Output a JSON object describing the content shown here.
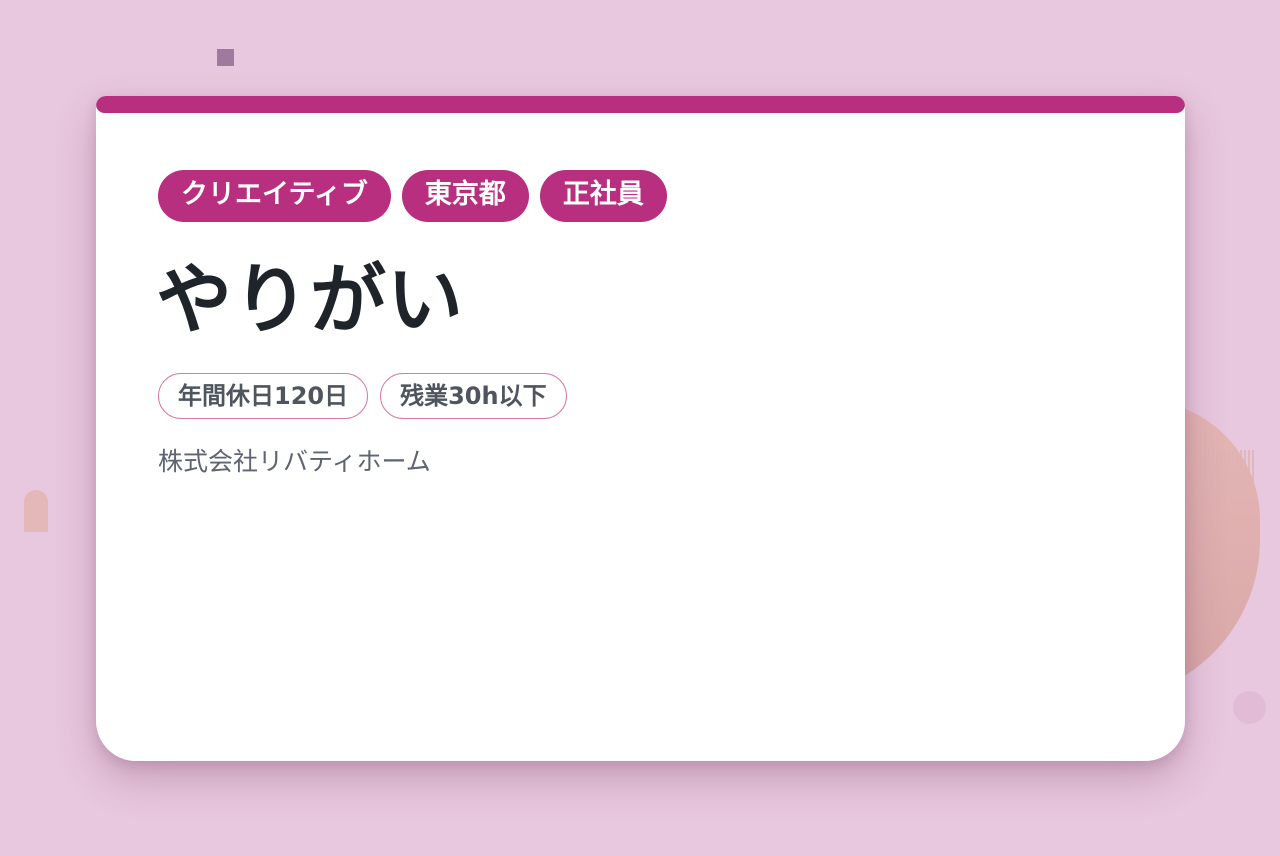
{
  "tags": [
    "クリエイティブ",
    "東京都",
    "正社員"
  ],
  "title": "やりがい",
  "conditions": [
    "年間休日120日",
    "残業30h以下"
  ],
  "company": "株式会社リバティホーム",
  "colors": {
    "accent": "#b72f7e",
    "background": "#e8c8de",
    "card": "#ffffff",
    "title_text": "#1f242b",
    "condition_border": "#d37aa8",
    "muted_text": "#5e6570"
  }
}
